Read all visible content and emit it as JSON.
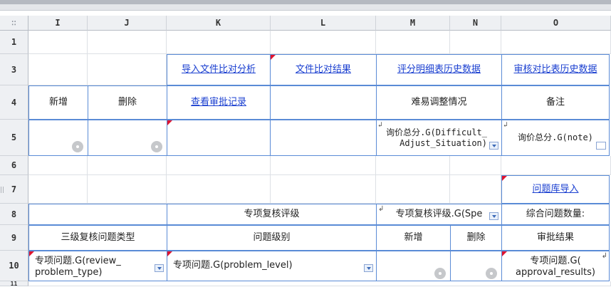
{
  "columns": [
    "I",
    "J",
    "K",
    "L",
    "M",
    "N",
    "O"
  ],
  "rows": [
    "1",
    "3",
    "4",
    "5",
    "6",
    "7",
    "8",
    "9",
    "10",
    "11"
  ],
  "corner_glyph": "∷",
  "cells": {
    "k3": "导入文件比对分析",
    "l3": "文件比对结果",
    "m3": "评分明细表历史数据",
    "o3": "审核对比表历史数据",
    "i4": "新增",
    "j4": "删除",
    "k4": "查看审批记录",
    "m4": "难易调整情况",
    "o4": "备注",
    "m5_line1": "询价总分.G(Difficult_",
    "m5_line2": "Adjust_Situation)",
    "o5": "询价总分.G(note)",
    "o7": "问题库导入",
    "k8": "专项复核评级",
    "m8": "专项复核评级.G(Spe",
    "o8": "综合问题数量:",
    "i9": "三级复核问题类型",
    "k9": "问题级别",
    "m9": "新增",
    "n9": "删除",
    "o9": "审批结果",
    "i10_line1": "专项问题.G(review_",
    "i10_line2": "problem_type)",
    "k10": "专项问题.G(problem_level)",
    "o10_line1": "专项问题.G(",
    "o10_line2": "approval_results)"
  },
  "colors": {
    "link": "#1a3fd0",
    "border_accent": "#5a8bd6",
    "corner_tag": "#e0142f",
    "header_bg": "#eef0f3"
  }
}
